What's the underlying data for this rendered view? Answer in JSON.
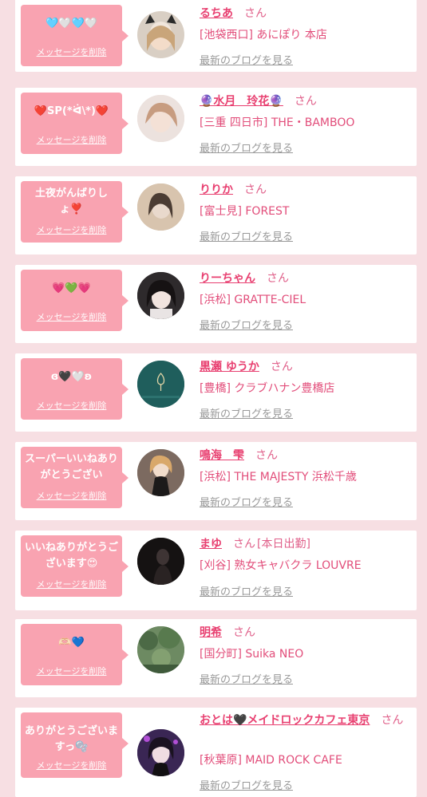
{
  "common": {
    "delete_label": "メッセージを削除",
    "blog_label": "最新のブログを見る",
    "honorific": "さん"
  },
  "entries": [
    {
      "message": "🩵🤍🩵🤍",
      "name": "るちあ",
      "status": "",
      "shop": "[池袋西口] あにぽり 本店",
      "avatar_icon": "avatar-girl-cat-ears",
      "avatar_color": "#d9cfc4"
    },
    {
      "message": "❤️SP(*ᐛ\\*)❤️",
      "name": "🔮水月　玲花🔮",
      "status": "",
      "shop": "[三重 四日市] THE・BAMBOO",
      "avatar_icon": "avatar-girl-blonde",
      "avatar_color": "#e8d7d2"
    },
    {
      "message": "土夜がんばりしょ❣️",
      "name": "りりか",
      "status": "",
      "shop": "[富士見] FOREST",
      "avatar_icon": "avatar-girl-blurred",
      "avatar_color": "#cbb59f"
    },
    {
      "message": "💗💚💗",
      "name": "りーちゃん",
      "status": "",
      "shop": "[浜松] GRATTE-CIEL",
      "avatar_icon": "avatar-girl-dark-hair",
      "avatar_color": "#3a3335"
    },
    {
      "message": "ɞ🖤🤍ʚ",
      "name": "黒瀬 ゆうか",
      "status": "",
      "shop": "[豊橋] クラブハナン豊橋店",
      "avatar_icon": "avatar-club-logo",
      "avatar_color": "#1f5e5c"
    },
    {
      "message": "スーパーいいねありがとうござい",
      "name": "鳴海　雫",
      "status": "",
      "shop": "[浜松] THE MAJESTY 浜松千歳",
      "avatar_icon": "avatar-girl-dress",
      "avatar_color": "#8a7468"
    },
    {
      "message": "いいねありがとうございます😍",
      "name": "まゆ",
      "status": "[本日出勤]",
      "shop": "[刈谷] 熟女キャバクラ LOUVRE",
      "avatar_icon": "avatar-dark-portrait",
      "avatar_color": "#1b1717"
    },
    {
      "message": "🫶🏻💙",
      "name": "明希",
      "status": "",
      "shop": "[国分町] Suika NEO",
      "avatar_icon": "avatar-forest-scene",
      "avatar_color": "#5f7a58"
    },
    {
      "message": "ありがとうございますっ🫧",
      "name": "おとは🖤メイドロックカフェ東京",
      "status": "",
      "shop": "[秋葉原] MAID ROCK CAFE",
      "avatar_icon": "avatar-maid-purple",
      "avatar_color": "#4a2f6b"
    }
  ]
}
